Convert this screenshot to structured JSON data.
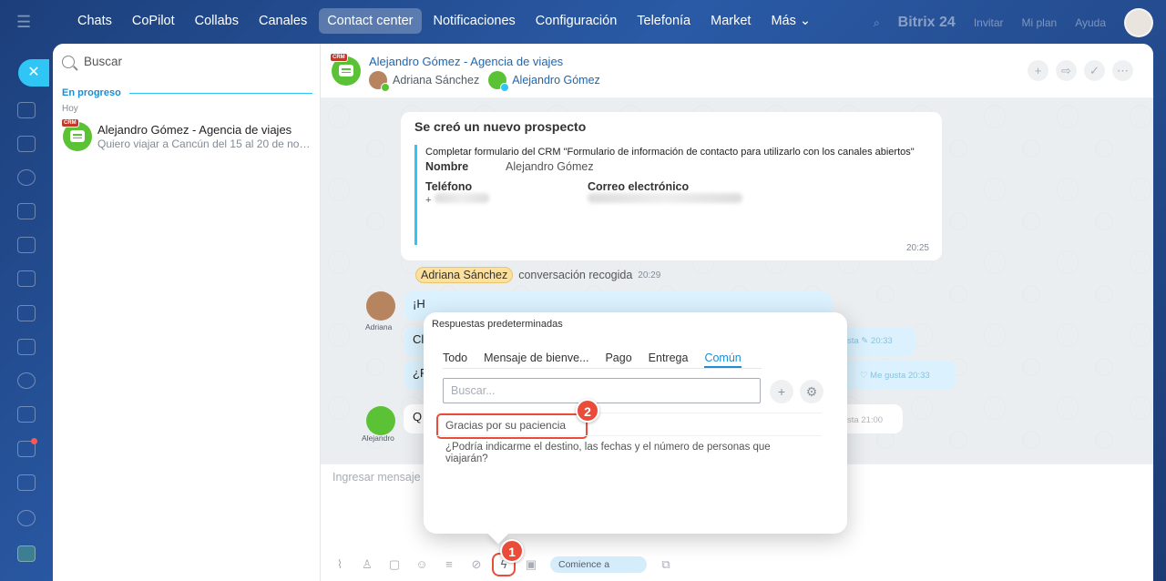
{
  "topnav": {
    "items": [
      "Chats",
      "CoPilot",
      "Collabs",
      "Canales",
      "Contact center",
      "Notificaciones",
      "Configuración",
      "Telefonía",
      "Market",
      "Más"
    ],
    "active_index": 4,
    "brand": "Bitrix 24",
    "right_links": [
      "Invitar",
      "Mi plan",
      "Ayuda"
    ]
  },
  "chat_list": {
    "search_placeholder": "Buscar",
    "section": "En progreso",
    "day": "Hoy",
    "item": {
      "badge": "CRM",
      "title": "Alejandro Gómez - Agencia de viajes",
      "preview": "Quiero viajar a Cancún del 15 al 20 de noviembre"
    }
  },
  "dialog": {
    "badge": "CRM",
    "title": "Alejandro Gómez - Agencia de viajes",
    "user_operator": "Adriana Sánchez",
    "user_client": "Alejandro Gómez",
    "system_card": {
      "heading": "Se creó un nuevo prospecto",
      "form_line": "Completar formulario del CRM \"Formulario de información de contacto para utilizarlo con los canales abiertos\"",
      "name_label": "Nombre",
      "name_value": "Alejandro Gómez",
      "phone_label": "Teléfono",
      "phone_value": "+",
      "email_label": "Correo electrónico",
      "time": "20:25"
    },
    "picked": {
      "name": "Adriana Sánchez",
      "text": "conversación recogida",
      "time": "20:29"
    },
    "messages": [
      {
        "author": "Adriana",
        "text": "¡H",
        "meta": ""
      },
      {
        "author": "",
        "text": "Cl",
        "meta": "sta  ✎ 20:33"
      },
      {
        "author": "",
        "text": "¿F",
        "meta": "♡ Me gusta  20:33"
      },
      {
        "author": "Alejandro",
        "text": "Q",
        "meta": "sta  21:00"
      }
    ],
    "composer_placeholder": "Ingresar mensaje",
    "start_chip": "Comience a"
  },
  "popup": {
    "title": "Respuestas predeterminadas",
    "tabs": [
      "Todo",
      "Mensaje de bienve...",
      "Pago",
      "Entrega",
      "Común"
    ],
    "active_tab": 4,
    "search_placeholder": "Buscar...",
    "replies": [
      "Gracias por su paciencia",
      "¿Podría indicarme el destino, las fechas y el número de personas que viajarán?"
    ]
  },
  "markers": [
    "1",
    "2"
  ],
  "colors": {
    "accent": "#2fc6f6",
    "crm_green": "#5bc236",
    "highlight_red": "#e94d3a",
    "link_blue": "#2066b0"
  }
}
